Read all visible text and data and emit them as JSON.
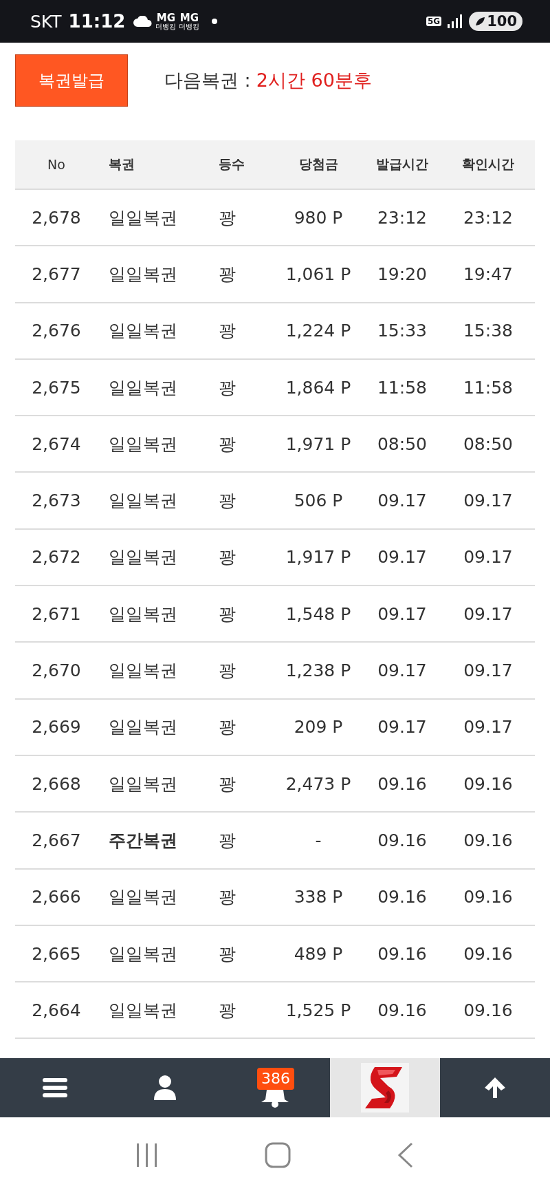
{
  "status_bar": {
    "carrier": "SKT",
    "time": "11:12",
    "notifications": [
      {
        "title": "MG",
        "subtitle": "더뱅킹"
      },
      {
        "title": "MG",
        "subtitle": "더뱅킹"
      }
    ],
    "network": "5G",
    "battery": "100"
  },
  "header": {
    "issue_button": "복권발급",
    "next_label": "다음복권 :",
    "next_value": "2시간 60분후"
  },
  "table": {
    "columns": [
      "No",
      "복권",
      "등수",
      "당첨금",
      "발급시간",
      "확인시간"
    ],
    "rows": [
      {
        "cells": [
          "2,678",
          "일일복권",
          "꽝",
          "980 P",
          "23:12",
          "23:12"
        ],
        "emphasized": false
      },
      {
        "cells": [
          "2,677",
          "일일복권",
          "꽝",
          "1,061 P",
          "19:20",
          "19:47"
        ],
        "emphasized": false
      },
      {
        "cells": [
          "2,676",
          "일일복권",
          "꽝",
          "1,224 P",
          "15:33",
          "15:38"
        ],
        "emphasized": false
      },
      {
        "cells": [
          "2,675",
          "일일복권",
          "꽝",
          "1,864 P",
          "11:58",
          "11:58"
        ],
        "emphasized": false
      },
      {
        "cells": [
          "2,674",
          "일일복권",
          "꽝",
          "1,971 P",
          "08:50",
          "08:50"
        ],
        "emphasized": false
      },
      {
        "cells": [
          "2,673",
          "일일복권",
          "꽝",
          "506 P",
          "09.17",
          "09.17"
        ],
        "emphasized": false
      },
      {
        "cells": [
          "2,672",
          "일일복권",
          "꽝",
          "1,917 P",
          "09.17",
          "09.17"
        ],
        "emphasized": false
      },
      {
        "cells": [
          "2,671",
          "일일복권",
          "꽝",
          "1,548 P",
          "09.17",
          "09.17"
        ],
        "emphasized": false
      },
      {
        "cells": [
          "2,670",
          "일일복권",
          "꽝",
          "1,238 P",
          "09.17",
          "09.17"
        ],
        "emphasized": false
      },
      {
        "cells": [
          "2,669",
          "일일복권",
          "꽝",
          "209 P",
          "09.17",
          "09.17"
        ],
        "emphasized": false
      },
      {
        "cells": [
          "2,668",
          "일일복권",
          "꽝",
          "2,473 P",
          "09.16",
          "09.16"
        ],
        "emphasized": false
      },
      {
        "cells": [
          "2,667",
          "주간복권",
          "꽝",
          "-",
          "09.16",
          "09.16"
        ],
        "emphasized": true
      },
      {
        "cells": [
          "2,666",
          "일일복권",
          "꽝",
          "338 P",
          "09.16",
          "09.16"
        ],
        "emphasized": false
      },
      {
        "cells": [
          "2,665",
          "일일복권",
          "꽝",
          "489 P",
          "09.16",
          "09.16"
        ],
        "emphasized": false
      },
      {
        "cells": [
          "2,664",
          "일일복권",
          "꽝",
          "1,525 P",
          "09.16",
          "09.16"
        ],
        "emphasized": false
      }
    ]
  },
  "bottom_nav": {
    "notification_count": "386"
  }
}
